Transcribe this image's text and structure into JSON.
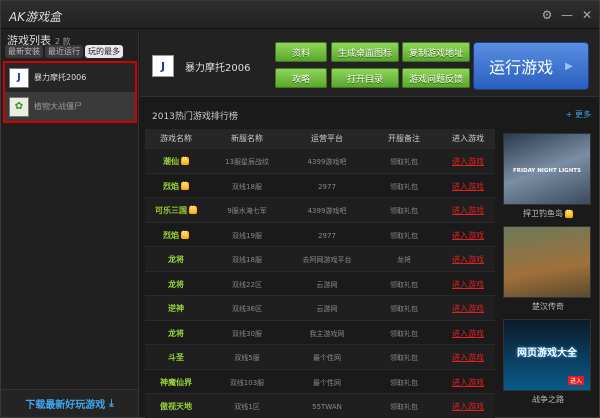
{
  "app": {
    "title": "AK游戏盒"
  },
  "sidebar": {
    "list_title": "游戏列表",
    "count": "2 款",
    "tabs": [
      "最新安装",
      "最近运行",
      "玩的最多"
    ],
    "games": [
      {
        "name": "暴力摩托2006",
        "icon": "moto-icon"
      },
      {
        "name": "植物大战僵尸",
        "icon": "plant-icon"
      }
    ],
    "footer": "下载最新好玩游戏"
  },
  "header": {
    "game_title": "暴力摩托2006",
    "buttons": [
      "资料",
      "生成桌面图标",
      "复制游戏地址",
      "攻略",
      "打开目录",
      "游戏问题反馈"
    ],
    "run_label": "运行游戏"
  },
  "ranking": {
    "title": "2013热门游戏排行榜",
    "more": "更多",
    "columns": [
      "游戏名称",
      "新服名称",
      "运营平台",
      "开服备注",
      "进入游戏"
    ],
    "rows": [
      {
        "game": "潮仙",
        "hot": "热",
        "server": "13服星辰战纹",
        "platform": "4399游戏吧",
        "note": "领取礼包",
        "enter": "进入游戏"
      },
      {
        "game": "烈焰",
        "hot": "热",
        "server": "双线18服",
        "platform": "2977",
        "note": "领取礼包",
        "enter": "进入游戏"
      },
      {
        "game": "可乐三国",
        "hot": "热",
        "server": "9服水淹七军",
        "platform": "4399游戏吧",
        "note": "领取礼包",
        "enter": "进入游戏"
      },
      {
        "game": "烈焰",
        "hot": "热",
        "server": "双线19服",
        "platform": "2977",
        "note": "领取礼包",
        "enter": "进入游戏"
      },
      {
        "game": "龙将",
        "hot": "",
        "server": "双线18服",
        "platform": "去阿网游戏平台",
        "note": "龙将",
        "enter": "进入游戏"
      },
      {
        "game": "龙将",
        "hot": "",
        "server": "双线22区",
        "platform": "云游网",
        "note": "领取礼包",
        "enter": "进入游戏"
      },
      {
        "game": "逆神",
        "hot": "",
        "server": "双线36区",
        "platform": "云游网",
        "note": "领取礼包",
        "enter": "进入游戏"
      },
      {
        "game": "龙将",
        "hot": "",
        "server": "双线30服",
        "platform": "我主游戏网",
        "note": "领取礼包",
        "enter": "进入游戏"
      },
      {
        "game": "斗圣",
        "hot": "",
        "server": "双线5服",
        "platform": "最个性网",
        "note": "领取礼包",
        "enter": "进入游戏"
      },
      {
        "game": "神魔仙界",
        "hot": "",
        "server": "双线103服",
        "platform": "最个性网",
        "note": "领取礼包",
        "enter": "进入游戏"
      },
      {
        "game": "傲视天地",
        "hot": "",
        "server": "双线1区",
        "platform": "55TWAN",
        "note": "领取礼包",
        "enter": "进入游戏"
      }
    ]
  },
  "ads": [
    {
      "caption": "捍卫钓鱼岛",
      "hot": "热",
      "image_text": "FRIDAY NIGHT LIGHTS"
    },
    {
      "caption": "楚汉传奇",
      "hot": "",
      "image_text": ""
    },
    {
      "caption": "战争之路",
      "hot": "",
      "image_text": "网页游戏大全",
      "button": "进入"
    }
  ]
}
